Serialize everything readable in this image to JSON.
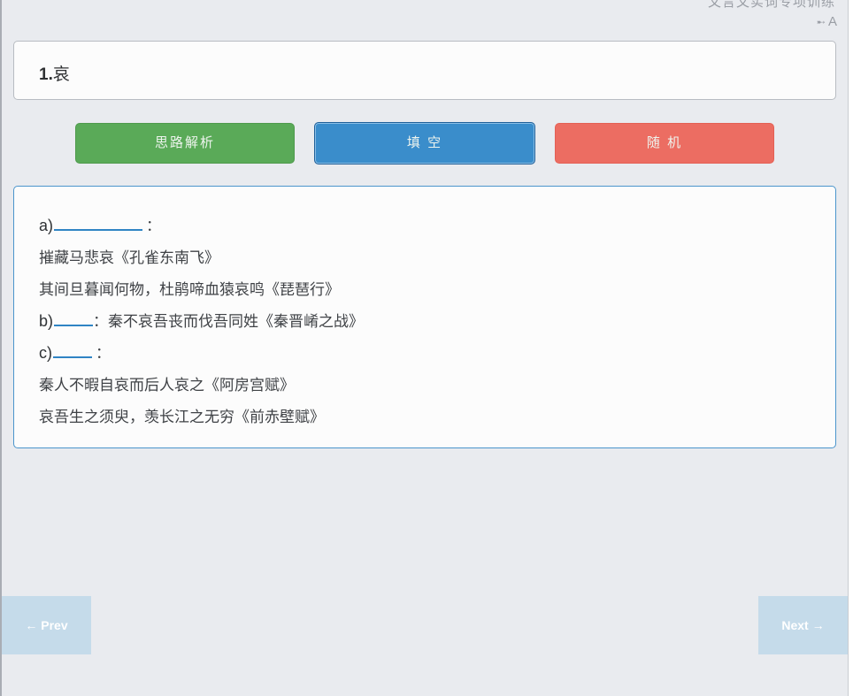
{
  "header": {
    "title": "文言文实词专项训练",
    "font_toggle_icon": "arrow-right-icon",
    "font_toggle_label": "A"
  },
  "question": {
    "number": "1.",
    "word": "哀"
  },
  "buttons": {
    "analysis": "思路解析",
    "fill": "填 空",
    "random": "随 机"
  },
  "content": {
    "a_label": "a)",
    "a_colon": "：",
    "a_examples": [
      "摧藏马悲哀《孔雀东南飞》",
      "其间旦暮闻何物，杜鹃啼血猿哀鸣《琵琶行》"
    ],
    "b_label": "b)",
    "b_text": "：秦不哀吾丧而伐吾同姓《秦晋崤之战》",
    "c_label": "c)",
    "c_colon": "：",
    "c_examples": [
      "秦人不暇自哀而后人哀之《阿房宫赋》",
      "哀吾生之须臾，羡长江之无穷《前赤壁赋》"
    ]
  },
  "nav": {
    "prev": "← Prev",
    "next": "Next →"
  },
  "colors": {
    "analysis_button": "#5aaa58",
    "fill_button": "#3a8dcb",
    "random_button": "#ec6d62",
    "nav_button": "#c5dbea",
    "blank_underline": "#2f84c4"
  }
}
